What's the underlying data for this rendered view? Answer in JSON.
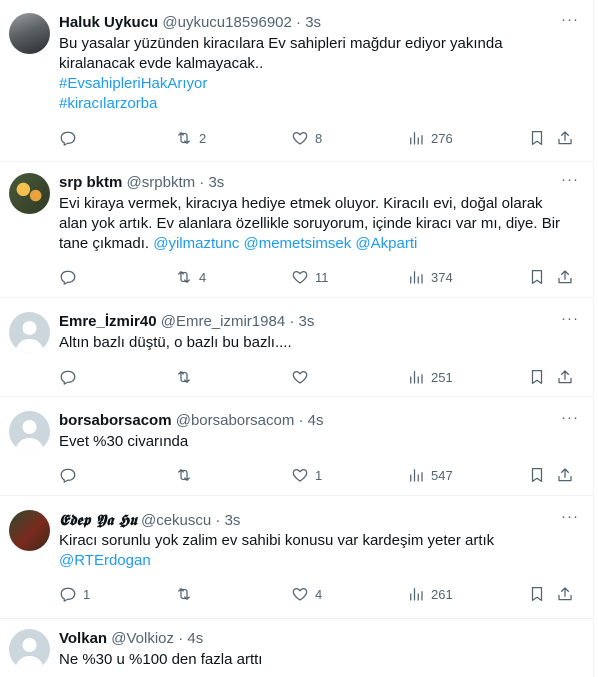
{
  "tweets": [
    {
      "name": "Haluk Uykucu",
      "handle": "@uykucu18596902",
      "time": "3s",
      "lines": [
        "Bu yasalar yüzünden kiracılara Ev sahipleri mağdur ediyor yakında",
        "kiralanacak evde kalmayacak.."
      ],
      "hashtags": [
        "#EvsahipleriHakArıyor",
        "#kiracılarzorba"
      ],
      "replies": "",
      "retweets": "2",
      "likes": "8",
      "views": "276"
    },
    {
      "name": "srp bktm",
      "handle": "@srpbktm",
      "time": "3s",
      "lines": [
        "Evi kiraya vermek, kiracıya hediye etmek oluyor. Kiracılı evi, doğal olarak",
        "alan yok artık. Ev alanlara özellikle soruyorum, içinde kiracı var mı, diye. Bir",
        "tane çıkmadı."
      ],
      "mentions": [
        "@yilmaztunc",
        "@memetsimsek",
        "@Akparti"
      ],
      "replies": "",
      "retweets": "4",
      "likes": "11",
      "views": "374"
    },
    {
      "name": "Emre_İzmir40",
      "handle": "@Emre_izmir1984",
      "time": "3s",
      "lines": [
        "Altın bazlı düştü, o bazlı bu bazlı...."
      ],
      "replies": "",
      "retweets": "",
      "likes": "",
      "views": "251"
    },
    {
      "name": "borsaborsacom",
      "handle": "@borsaborsacom",
      "time": "4s",
      "lines": [
        "Evet %30 civarında"
      ],
      "replies": "",
      "retweets": "",
      "likes": "1",
      "views": "547"
    },
    {
      "name": "𝕰𝖉𝖊𝖕 𝖄𝖆 𝕳𝖚",
      "handle": "@cekuscu",
      "time": "3s",
      "lines": [
        "Kiracı sorunlu yok zalim ev sahibi konusu var kardeşim yeter artık"
      ],
      "mention": "@RTErdogan",
      "replies": "1",
      "retweets": "",
      "likes": "4",
      "views": "261"
    },
    {
      "name": "Volkan",
      "handle": "@Volkioz",
      "time": "4s",
      "lines": [
        "Ne %30 u %100 den fazla arttı"
      ]
    }
  ],
  "ui": {
    "separator": "·",
    "more": "···"
  },
  "icons": {
    "reply": "reply-icon",
    "retweet": "retweet-icon",
    "like": "heart-icon",
    "views": "views-icon",
    "bookmark": "bookmark-icon",
    "share": "share-icon",
    "more": "more-icon"
  },
  "colors": {
    "link": "#1d9bf0",
    "secondary": "#536471",
    "border": "#eff3f4",
    "text": "#0f1419"
  }
}
